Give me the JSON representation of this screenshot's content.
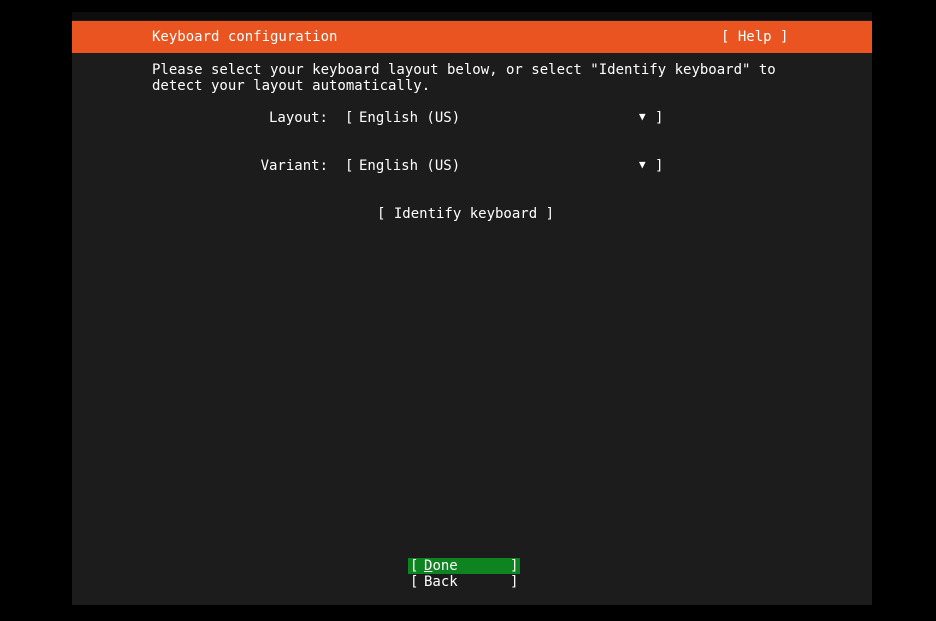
{
  "header": {
    "title": "Keyboard configuration",
    "help_label": "[ Help ]"
  },
  "intro": {
    "text": "Please select your keyboard layout below, or select \"Identify keyboard\" to\ndetect your layout automatically."
  },
  "form": {
    "layout": {
      "label": "Layout:",
      "open_bracket": "[",
      "value": "English (US)",
      "arrow": "▼",
      "close_bracket": "]"
    },
    "variant": {
      "label": "Variant:",
      "open_bracket": "[",
      "value": "English (US)",
      "arrow": "▼",
      "close_bracket": "]"
    },
    "identify_label": "[ Identify keyboard ]"
  },
  "footer": {
    "done": {
      "open_bracket": "[",
      "label_first": "D",
      "label_rest": "one",
      "close_bracket": "]"
    },
    "back": {
      "open_bracket": "[",
      "label": "Back",
      "close_bracket": "]"
    }
  },
  "colors": {
    "header_bg": "#e95420",
    "screen_bg": "#1c1c1c",
    "done_bg": "#0e8420"
  }
}
